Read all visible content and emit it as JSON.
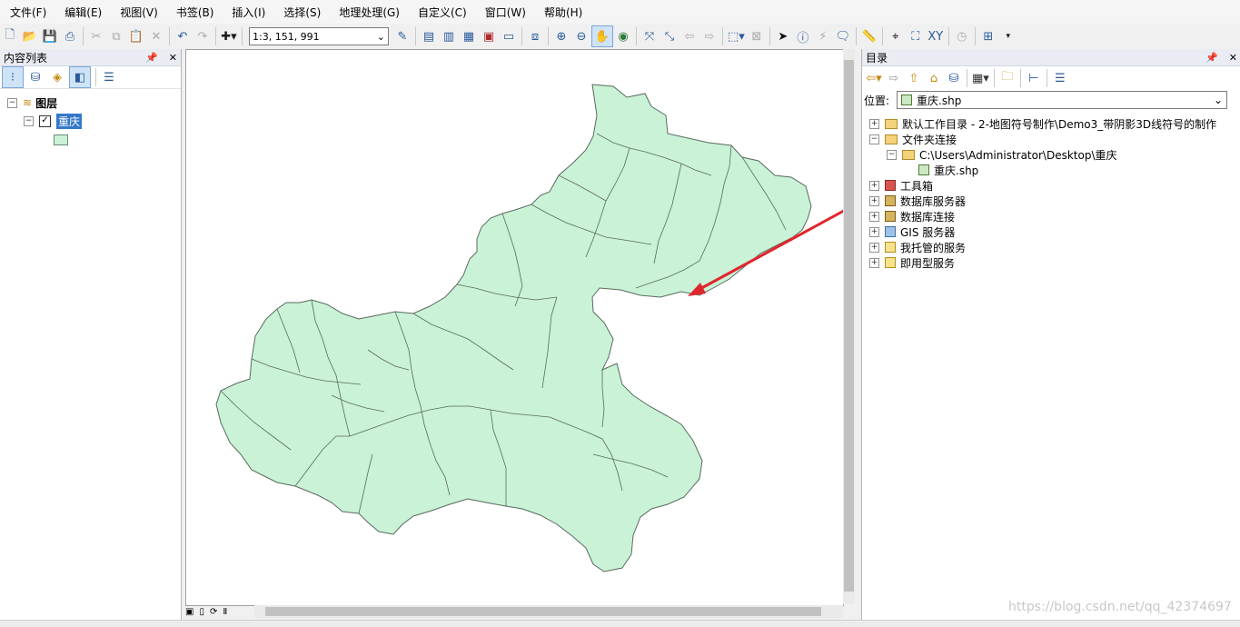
{
  "menu": [
    "文件(F)",
    "编辑(E)",
    "视图(V)",
    "书签(B)",
    "插入(I)",
    "选择(S)",
    "地理处理(G)",
    "自定义(C)",
    "窗口(W)",
    "帮助(H)"
  ],
  "toolbar": {
    "scale": "1:3, 151, 991"
  },
  "toc": {
    "title": "内容列表",
    "layers_label": "图层",
    "layer_name": "重庆",
    "layer_checked": "✓"
  },
  "catalog": {
    "title": "目录",
    "location_label": "位置:",
    "location_value": "重庆.shp",
    "items": {
      "home": "默认工作目录 - 2-地图符号制作\\Demo3_带阴影3D线符号的制作",
      "folder_connections": "文件夹连接",
      "folder_path": "C:\\Users\\Administrator\\Desktop\\重庆",
      "shapefile": "重庆.shp",
      "toolbox": "工具箱",
      "db_servers": "数据库服务器",
      "db_connections": "数据库连接",
      "gis_servers": "GIS 服务器",
      "my_hosted": "我托管的服务",
      "ready_services": "即用型服务"
    }
  },
  "colors": {
    "map_fill": "#c9f2d6",
    "map_stroke": "#5a6a5e",
    "arrow": "#e0262c",
    "selection": "#3478c8"
  },
  "watermark": "https://blog.csdn.net/qq_42374697"
}
